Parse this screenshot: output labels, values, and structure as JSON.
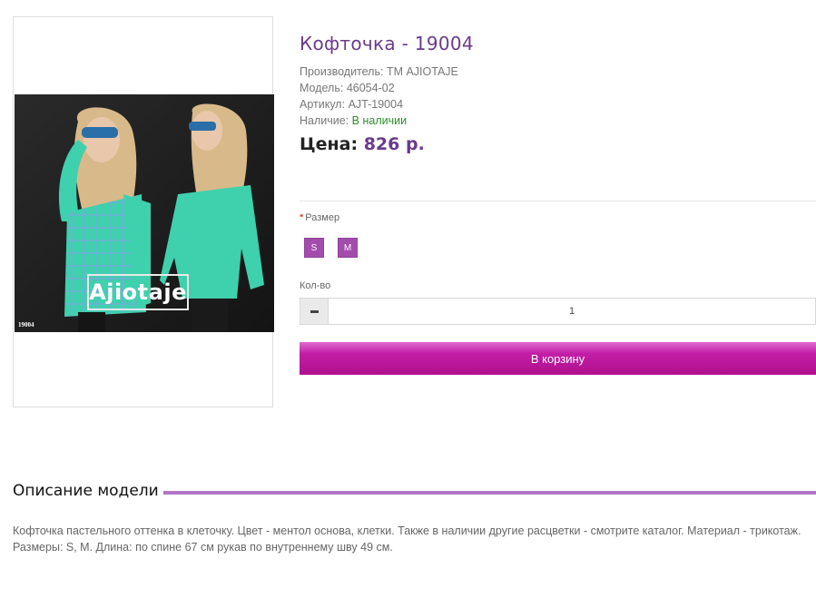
{
  "product": {
    "title": "Кофточка - 19004",
    "manufacturer_label": "Производитель:",
    "manufacturer_value": "ТМ AJIOTAJE",
    "model_label": "Модель:",
    "model_value": "46054-02",
    "sku_label": "Артикул:",
    "sku_value": "AJT-19004",
    "availability_label": "Наличие:",
    "availability_value": "В наличии",
    "price_label": "Цена:",
    "price_value": "826 р."
  },
  "image": {
    "brand_text": "Ajiotaje",
    "sku_tag": "19004"
  },
  "options": {
    "size_required_mark": "*",
    "size_label": "Размер",
    "sizes": [
      "S",
      "M"
    ],
    "qty_label": "Кол-во",
    "qty_value": "1",
    "cart_label": "В корзину"
  },
  "description": {
    "title": "Описание модели",
    "text": "Кофточка пастельного оттенка в клеточку. Цвет - ментол основа, клетки. Также в наличии другие расцветки - смотрите каталог. Материал - трикотаж. Размеры: S, M. Длина: по спине 67 см рукав по внутреннему шву 49 см."
  },
  "colors": {
    "accent": "#6b3a8a",
    "size_button": "#a24cab",
    "cart_button": "#c21ea6",
    "in_stock": "#2e8b2e",
    "section_rule": "#b274c4"
  }
}
